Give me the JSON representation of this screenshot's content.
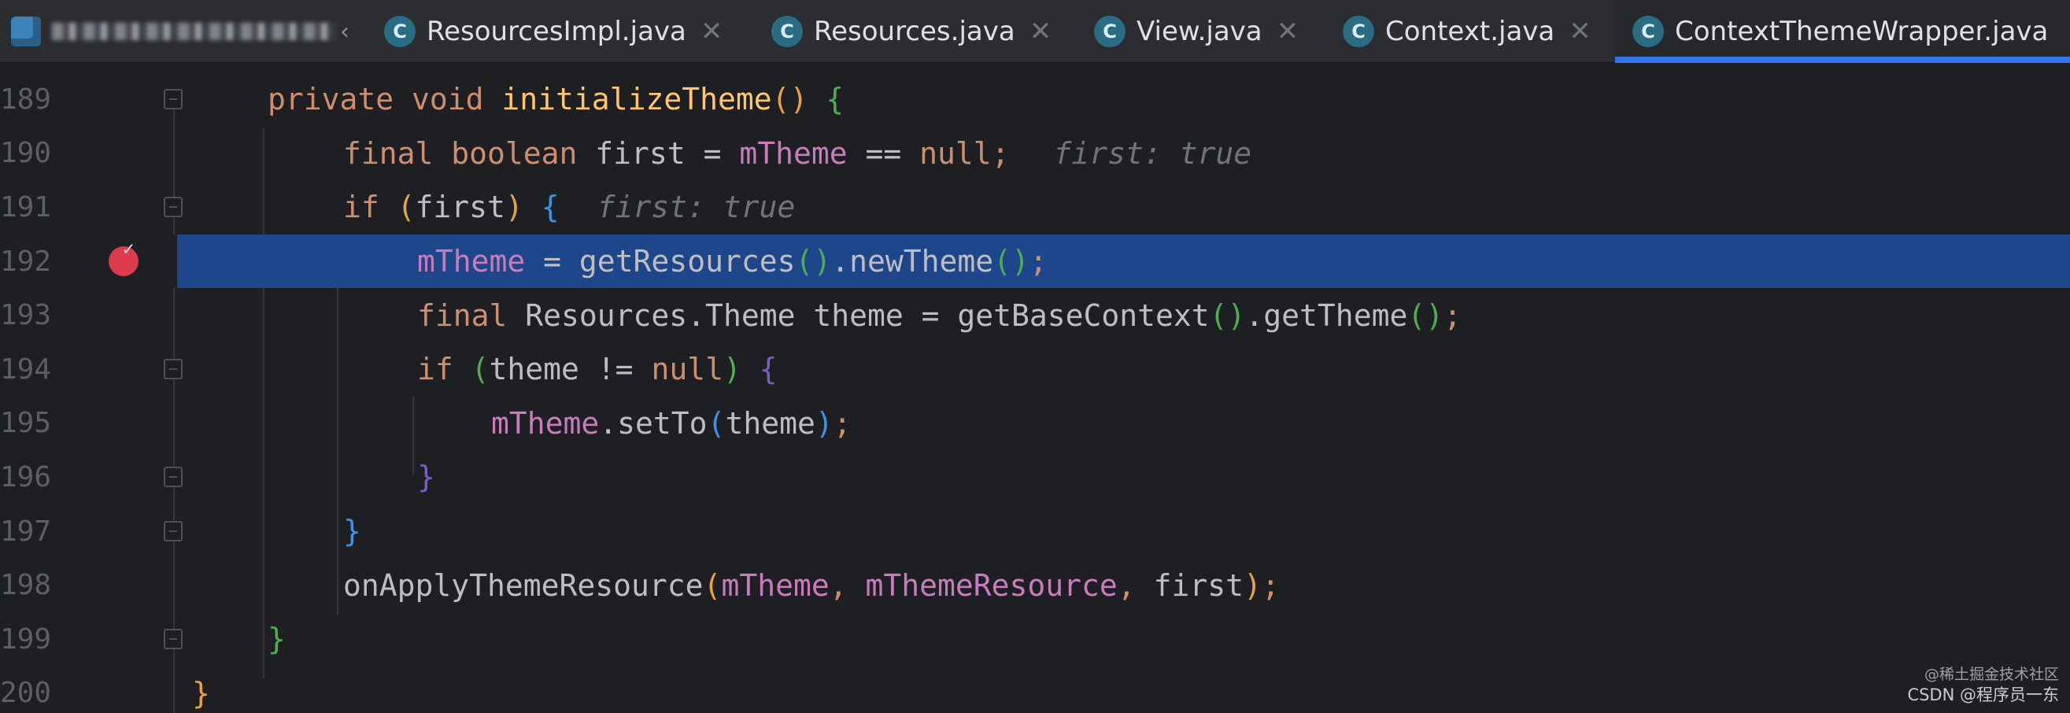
{
  "tabs": [
    {
      "label": "ResourcesImpl.java",
      "icon": "java-class-icon",
      "closable": true
    },
    {
      "label": "Resources.java",
      "icon": "java-class-icon",
      "closable": true
    },
    {
      "label": "View.java",
      "icon": "java-class-icon",
      "closable": true
    },
    {
      "label": "Context.java",
      "icon": "java-class-icon",
      "closable": true
    },
    {
      "label": "ContextThemeWrapper.java",
      "icon": "java-class-icon",
      "active": true
    }
  ],
  "tab_icon_letter": "C",
  "close_glyph": "✕",
  "project_chevron": "‹",
  "editor": {
    "line_numbers": [
      "189",
      "190",
      "191",
      "192",
      "193",
      "194",
      "195",
      "196",
      "197",
      "198",
      "199",
      "200"
    ],
    "current_line": "192",
    "inlay_hints": [
      "first: true",
      "first: true"
    ],
    "breakpoint_check": "✓"
  },
  "watermark": {
    "line1": "@稀土掘金技术社区",
    "line2": "CSDN @程序员一东"
  },
  "colors": {
    "keyword": "#cf8e6d",
    "field": "#c77dbb",
    "method_call": "#56a8f5",
    "method_decl": "#ffc66d",
    "current_line": "#1d468b",
    "breakpoint": "#db3b4b",
    "tab_accent": "#3574f0"
  }
}
